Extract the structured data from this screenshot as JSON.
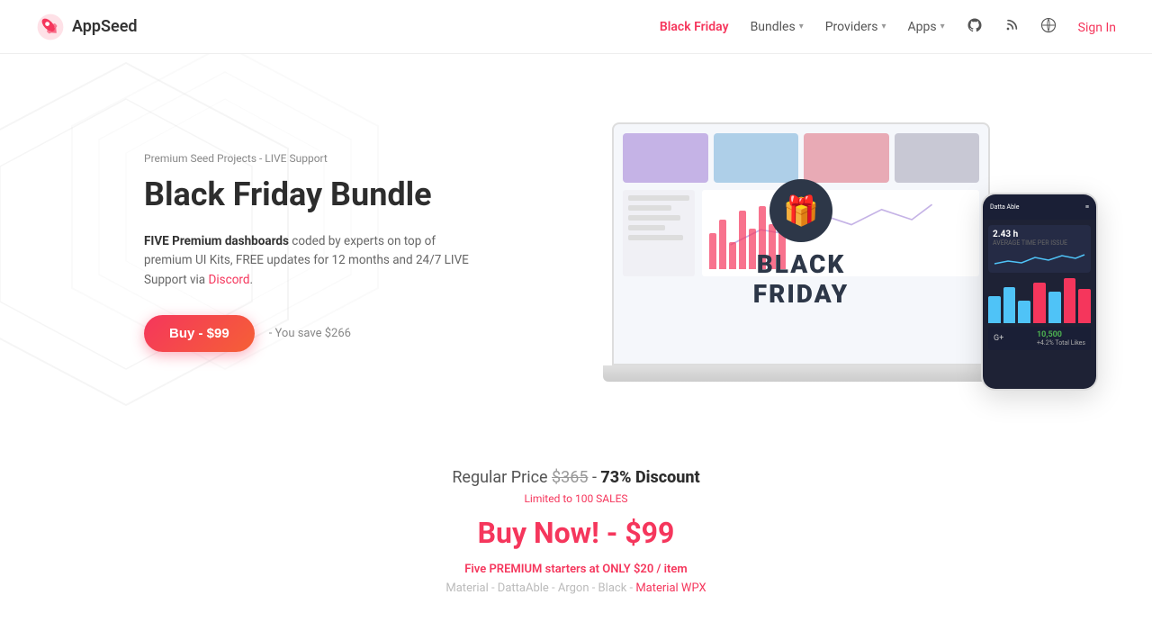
{
  "brand": {
    "name": "AppSeed",
    "logo_alt": "AppSeed rocket logo"
  },
  "nav": {
    "items": [
      {
        "label": "Black Friday",
        "active": true,
        "has_dropdown": false
      },
      {
        "label": "Bundles",
        "active": false,
        "has_dropdown": true
      },
      {
        "label": "Providers",
        "active": false,
        "has_dropdown": true
      },
      {
        "label": "Apps",
        "active": false,
        "has_dropdown": true
      }
    ],
    "icons": [
      "github-icon",
      "rss-icon",
      "wordpress-icon"
    ],
    "sign_in": "Sign In"
  },
  "hero": {
    "subtitle": "Premium Seed Projects - LIVE Support",
    "title": "Black Friday Bundle",
    "desc_part1": "FIVE Premium dashboards",
    "desc_part2": " coded by experts on top of premium UI Kits, FREE updates for 12 months and 24/7 LIVE Support via ",
    "desc_link": "Discord",
    "desc_end": ".",
    "buy_button": "Buy - $99",
    "save_text": "- You save $266",
    "bf_label": "BLACK FRIDAY"
  },
  "pricing": {
    "regular_label": "Regular Price",
    "regular_price": "$365",
    "discount": "73% Discount",
    "limited": "Limited to 100 SALES",
    "buy_now": "Buy Now! - $99",
    "five_premium_prefix": "Five ",
    "five_premium_highlight": "PREMIUM",
    "five_premium_suffix": " starters at ",
    "only_highlight": "ONLY $20 / item",
    "items_prefix": "Material - DattaAble - Argon - Black - ",
    "items_link": "Material WPX"
  },
  "colors": {
    "accent": "#f5365c",
    "dark": "#2d3748",
    "text_muted": "#888"
  }
}
